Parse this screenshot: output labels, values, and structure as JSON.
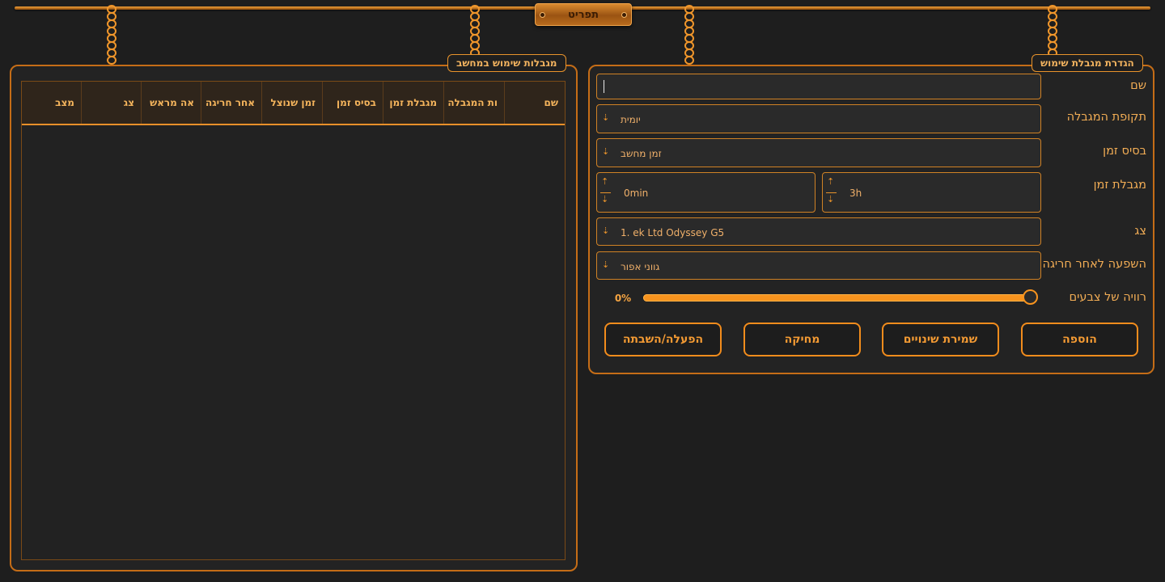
{
  "top_menu": {
    "label": "תפריט"
  },
  "list_panel": {
    "title": "מגבלות שימוש במחשב",
    "columns": [
      "שם",
      "ות המגבלה",
      "מגבלת זמן",
      "בסיס זמן",
      "זמן שנוצל",
      "אחר חריגה",
      "אה מראש",
      "צג",
      "מצב"
    ],
    "rows": []
  },
  "form_panel": {
    "title": "הגדרת מגבלת שימוש",
    "name": {
      "label": "שם",
      "value": ""
    },
    "period": {
      "label": "תקופת המגבלה",
      "value": "יומית"
    },
    "time_base": {
      "label": "בסיס זמן",
      "value": "זמן מחשב"
    },
    "time_limit": {
      "label": "מגבלת זמן",
      "hours": "3h",
      "minutes": "0min"
    },
    "monitor": {
      "label": "צג",
      "value": "1. ek Ltd Odyssey G5"
    },
    "after_exceed": {
      "label": "השפעה לאחר חריגה",
      "value": "גווני אפור"
    },
    "saturation": {
      "label": "רוויה של צבעים",
      "value_text": "0%",
      "value": 0
    },
    "buttons": {
      "add": "הוספה",
      "save": "שמירת שינויים",
      "delete": "מחיקה",
      "toggle": "הפעלה/השבתה"
    }
  },
  "icons": {
    "select_arrow": "arrow-down-icon",
    "spin_up": "arrow-up-icon",
    "spin_down": "arrow-down-icon"
  },
  "colors": {
    "accent": "#f28c1c",
    "background": "#1e1e1e",
    "panel": "#232323"
  }
}
